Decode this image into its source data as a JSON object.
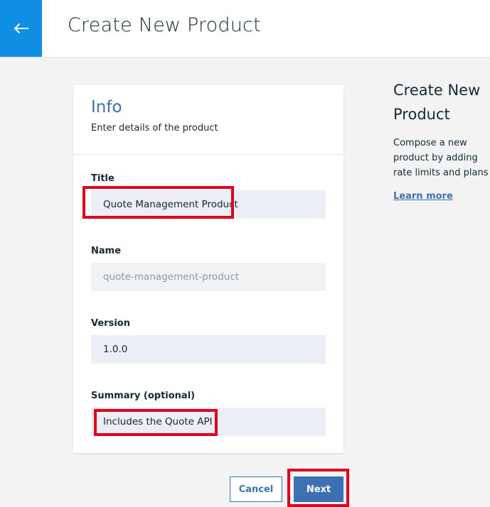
{
  "header": {
    "title": "Create New Product",
    "back_icon": "arrow-left-icon",
    "accent_color": "#0f8ee4"
  },
  "card": {
    "title": "Info",
    "subtitle": "Enter details of the product"
  },
  "fields": {
    "title": {
      "label": "Title",
      "value": "Quote Management Product"
    },
    "name": {
      "label": "Name",
      "value": "quote-management-product"
    },
    "version": {
      "label": "Version",
      "value": "1.0.0"
    },
    "summary": {
      "label": "Summary (optional)",
      "value": "Includes the Quote API"
    }
  },
  "sidebar": {
    "title": "Create New Product",
    "description": "Compose a new product by adding rate limits and plans",
    "link": "Learn more"
  },
  "footer": {
    "cancel_label": "Cancel",
    "next_label": "Next"
  },
  "colors": {
    "highlight": "#e0001b",
    "primary": "#3d70b2"
  }
}
